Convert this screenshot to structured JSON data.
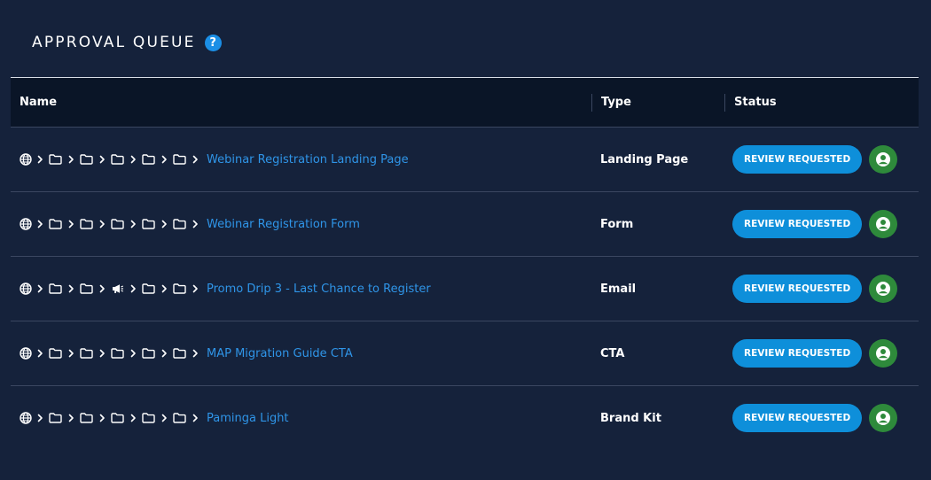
{
  "header": {
    "title": "APPROVAL QUEUE",
    "help_glyph": "?"
  },
  "table": {
    "columns": {
      "name": "Name",
      "type": "Type",
      "status": "Status"
    },
    "rows": [
      {
        "path": [
          "globe",
          "folder",
          "folder",
          "folder",
          "folder",
          "folder"
        ],
        "name": "Webinar Registration Landing Page",
        "type": "Landing Page",
        "status": "REVIEW REQUESTED"
      },
      {
        "path": [
          "globe",
          "folder",
          "folder",
          "folder",
          "folder",
          "folder"
        ],
        "name": "Webinar Registration Form",
        "type": "Form",
        "status": "REVIEW REQUESTED"
      },
      {
        "path": [
          "globe",
          "folder",
          "folder",
          "megaphone",
          "folder",
          "folder"
        ],
        "name": "Promo Drip 3 - Last Chance to Register",
        "type": "Email",
        "status": "REVIEW REQUESTED"
      },
      {
        "path": [
          "globe",
          "folder",
          "folder",
          "folder",
          "folder",
          "folder"
        ],
        "name": "MAP Migration Guide CTA",
        "type": "CTA",
        "status": "REVIEW REQUESTED"
      },
      {
        "path": [
          "globe",
          "folder",
          "folder",
          "folder",
          "folder",
          "folder"
        ],
        "name": "Paminga Light",
        "type": "Brand Kit",
        "status": "REVIEW REQUESTED"
      }
    ]
  },
  "colors": {
    "background": "#15223b",
    "header_bg": "#0a1527",
    "link": "#2f95e8",
    "badge": "#0e8fda",
    "avatar": "#2e8a3b",
    "help": "#1b8fe6"
  }
}
